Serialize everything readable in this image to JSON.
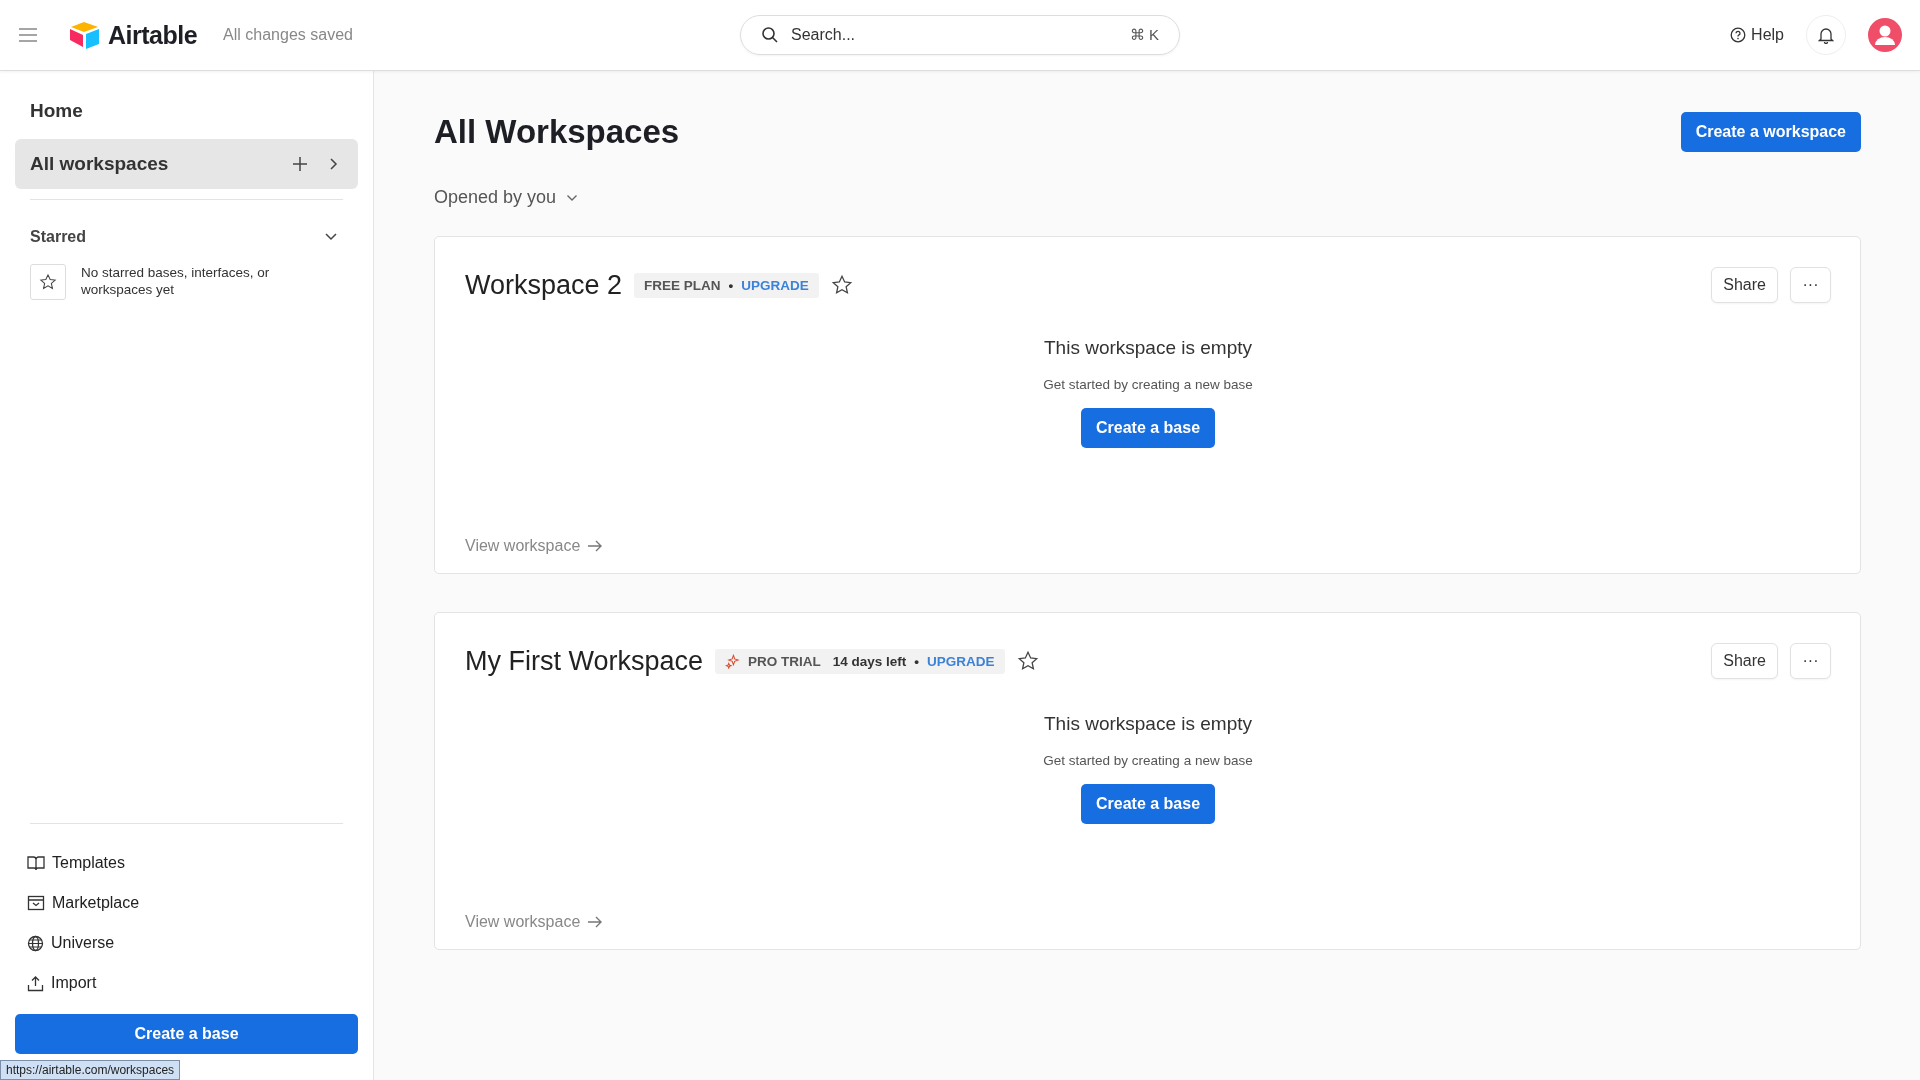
{
  "header": {
    "brand": "Airtable",
    "save_status": "All changes saved",
    "search": {
      "placeholder": "Search...",
      "shortcut": "⌘ K"
    },
    "help": "Help"
  },
  "sidebar": {
    "home": "Home",
    "nav": [
      {
        "label": "All workspaces",
        "selected": true
      }
    ],
    "starred": {
      "title": "Starred",
      "expanded": true,
      "empty": "No starred bases, interfaces, or workspaces yet"
    },
    "links": [
      {
        "label": "Templates",
        "kind": "book"
      },
      {
        "label": "Marketplace",
        "kind": "market"
      },
      {
        "label": "Universe",
        "kind": "globe"
      },
      {
        "label": "Import",
        "kind": "upload"
      }
    ],
    "create_button": "Create a base"
  },
  "main": {
    "title": "All Workspaces",
    "create_button": "Create a workspace",
    "sort": "Opened by you",
    "workspaces": [
      {
        "name": "Workspace 2",
        "plan": {
          "kind": "free",
          "label": "FREE PLAN",
          "separator": "•",
          "upgrade": "UPGRADE"
        },
        "starred": false,
        "share": "Share",
        "more": "···",
        "empty_title": "This workspace is empty",
        "empty_hint": "Get started by creating a new base",
        "create_button": "Create a base",
        "view_link": "View workspace"
      },
      {
        "name": "My First Workspace",
        "plan": {
          "kind": "trial",
          "label": "PRO TRIAL",
          "days_left": "14 days left",
          "separator": "•",
          "upgrade": "UPGRADE"
        },
        "starred": false,
        "share": "Share",
        "more": "···",
        "empty_title": "This workspace is empty",
        "empty_hint": "Get started by creating a new base",
        "create_button": "Create a base",
        "view_link": "View workspace"
      }
    ]
  },
  "status_url": "https://airtable.com/workspaces"
}
